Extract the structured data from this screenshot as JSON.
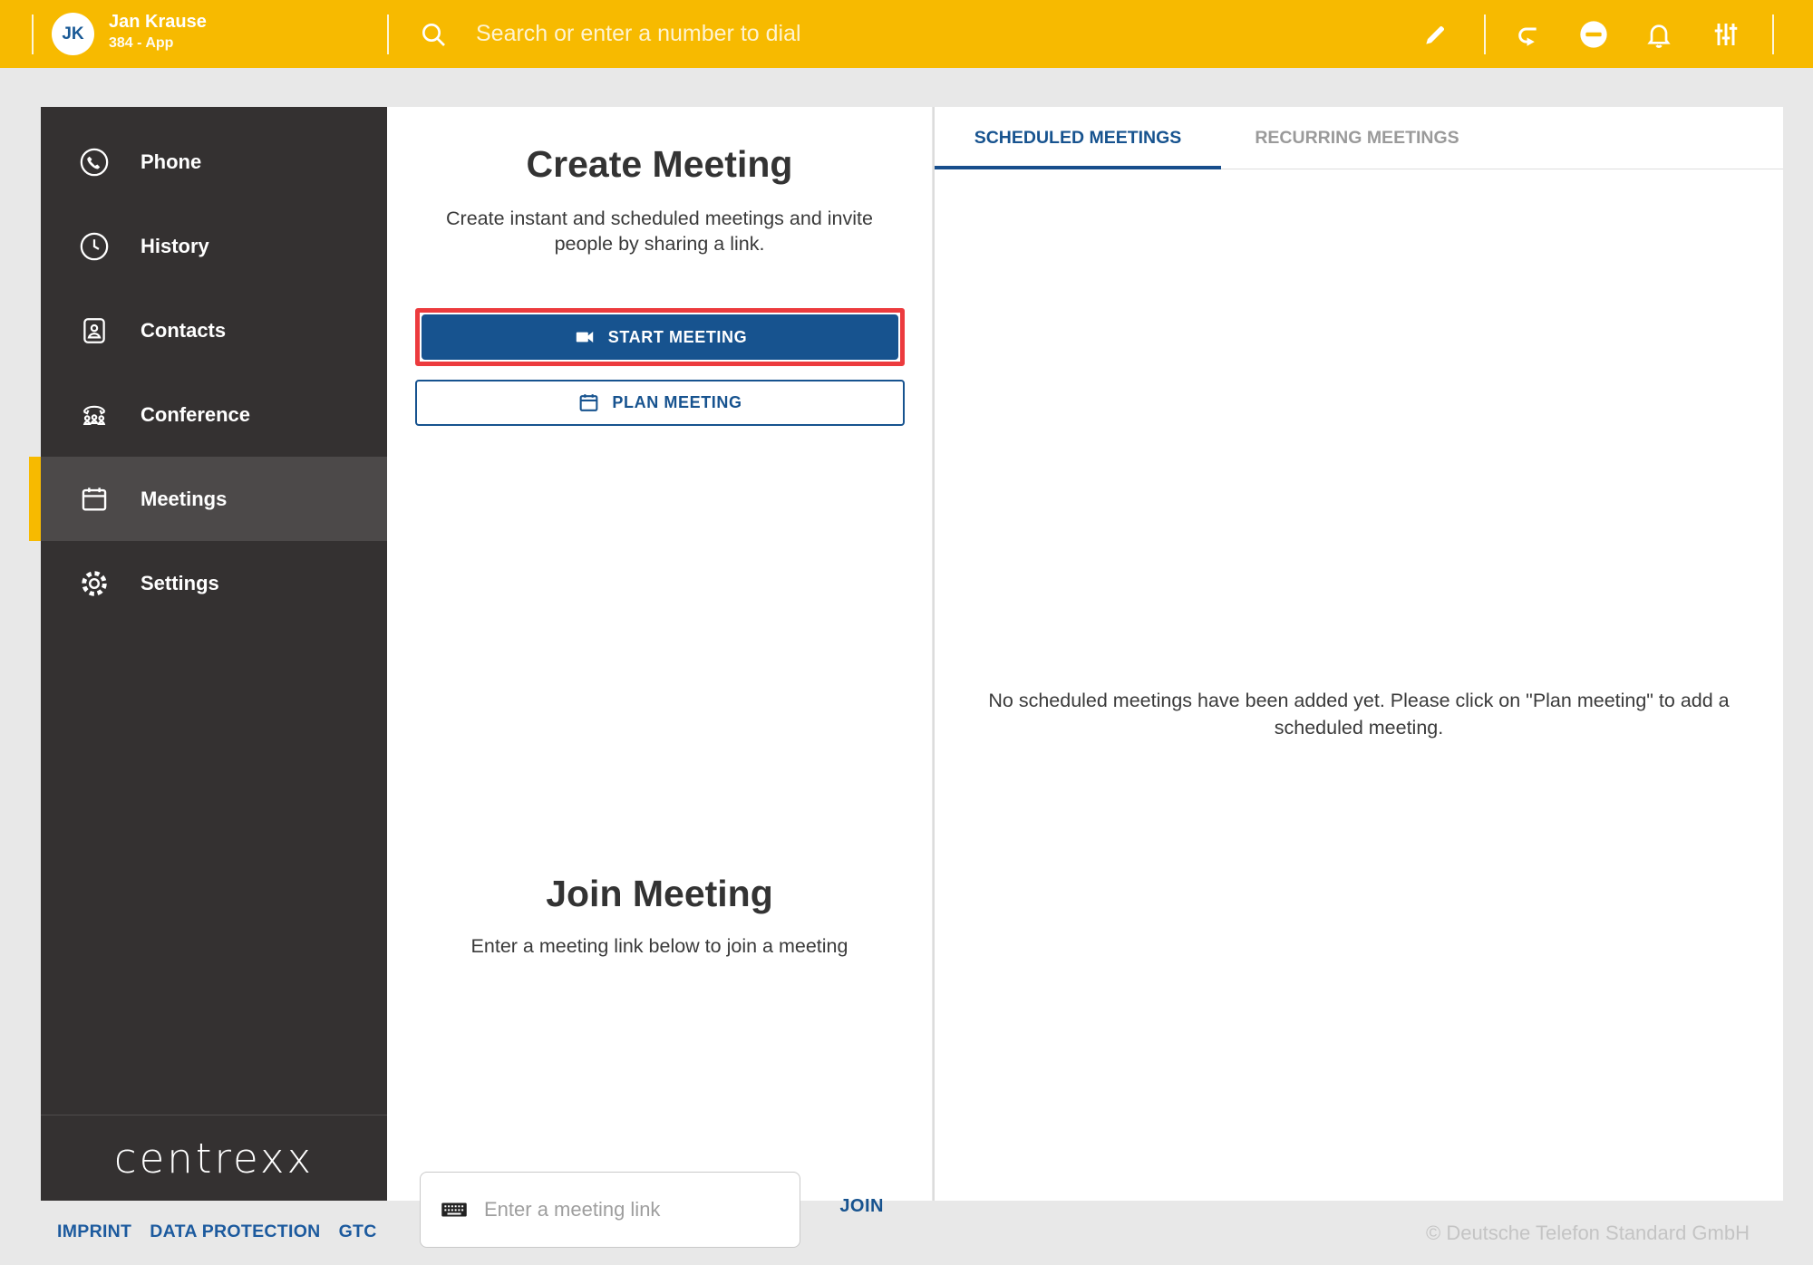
{
  "header": {
    "avatar_initials": "JK",
    "user_name": "Jan Krause",
    "user_extension": "384 - App",
    "search_placeholder": "Search or enter a number to dial",
    "icons": {
      "search": "search-icon",
      "pencil": "pencil-icon",
      "redirect": "call-forward-icon",
      "dnd": "do-not-disturb-icon",
      "bell": "notifications-icon",
      "sliders": "tune-settings-icon"
    }
  },
  "sidebar": {
    "items": [
      {
        "label": "Phone",
        "icon": "phone-icon",
        "active": false
      },
      {
        "label": "History",
        "icon": "history-icon",
        "active": false
      },
      {
        "label": "Contacts",
        "icon": "contacts-icon",
        "active": false
      },
      {
        "label": "Conference",
        "icon": "conference-icon",
        "active": false
      },
      {
        "label": "Meetings",
        "icon": "meetings-icon",
        "active": true
      },
      {
        "label": "Settings",
        "icon": "settings-icon",
        "active": false
      }
    ],
    "logo": "centrexx"
  },
  "create_meeting": {
    "title": "Create Meeting",
    "subtitle": "Create instant and scheduled meetings and invite people by sharing a link.",
    "start_button": "START MEETING",
    "plan_button": "PLAN MEETING"
  },
  "join_meeting": {
    "title": "Join Meeting",
    "subtitle": "Enter a meeting link below to join a meeting",
    "input_placeholder": "Enter a meeting link",
    "join_button": "JOIN"
  },
  "meetings_panel": {
    "tabs": [
      {
        "label": "SCHEDULED MEETINGS",
        "active": true
      },
      {
        "label": "RECURRING MEETINGS",
        "active": false
      }
    ],
    "empty_message": "No scheduled meetings have been added yet. Please click on \"Plan meeting\" to add a scheduled meeting."
  },
  "footer": {
    "links": [
      "IMPRINT",
      "DATA PROTECTION",
      "GTC"
    ],
    "copyright": "© Deutsche Telefon Standard GmbH"
  },
  "colors": {
    "brand_yellow": "#F7BA00",
    "primary_blue": "#17538F",
    "sidebar_dark": "#343131",
    "sidebar_active_bg": "#4C4949",
    "highlight_red": "#EC3B3E",
    "page_background": "#E8E8E8",
    "inactive_tab_gray": "#9A9A9A"
  }
}
